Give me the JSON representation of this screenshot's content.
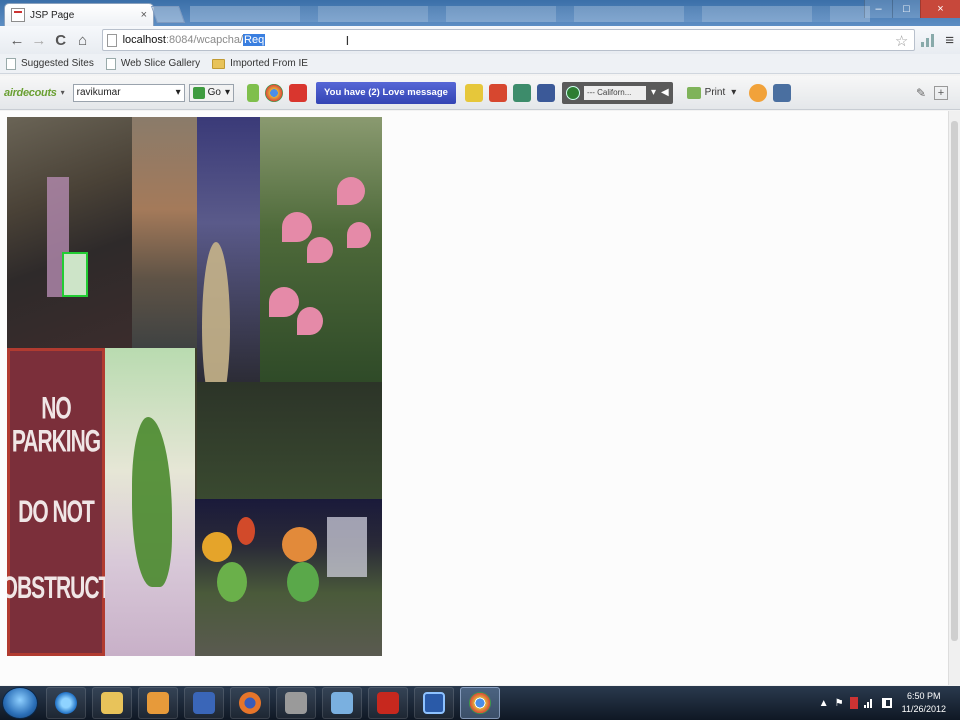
{
  "browser": {
    "tab_title": "JSP Page",
    "tab_close": "×",
    "window_controls": {
      "minimize": "–",
      "maximize": "□",
      "close": "×"
    },
    "url_host": "localhost",
    "url_path": ":8084/wcapcha/",
    "url_selected": "Req",
    "caret": "I",
    "star_glyph": "☆",
    "menu_glyph": "≡",
    "nav": {
      "back": "←",
      "forward": "→",
      "reload": "C",
      "home": "⌂"
    }
  },
  "bookmarks": {
    "items": [
      {
        "label": "Suggested Sites",
        "icon": "page-icon"
      },
      {
        "label": "Web Slice Gallery",
        "icon": "page-icon"
      },
      {
        "label": "Imported From IE",
        "icon": "folder-icon"
      }
    ]
  },
  "toolbar": {
    "logo": "airdecouts",
    "logo_arrow": "▾",
    "user_value": "ravikumar",
    "user_arrow": "▾",
    "go_label": "Go",
    "go_arrow": "▾",
    "love_message": "You have (2) Love message",
    "player_station": "--- Californ...",
    "player_arrow": "▾",
    "player_volume": "◀",
    "print_label": "Print",
    "print_arrow": "▾",
    "wrench": "✎",
    "plus": "+"
  },
  "captcha": {
    "sign_lines": [
      "NO PARKING",
      "DO NOT",
      "OBSTRUCT"
    ]
  },
  "taskbar": {
    "clock_time": "6:50 PM",
    "clock_date": "11/26/2012",
    "tray_arrow": "▲",
    "tray_flag": "⚑"
  }
}
